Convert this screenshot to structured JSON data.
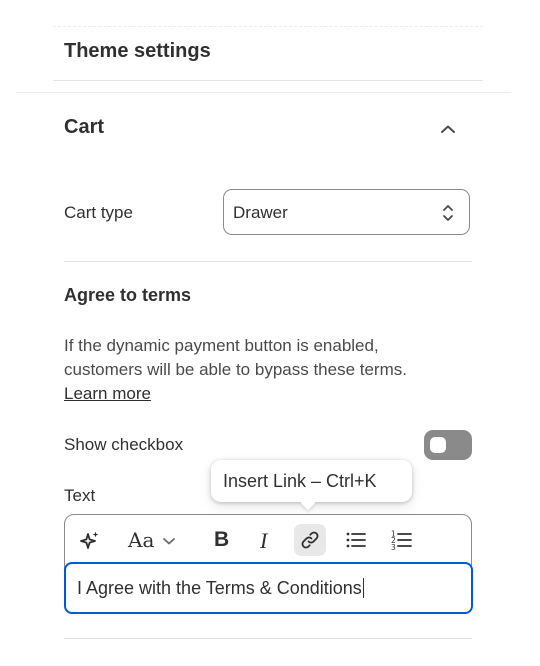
{
  "header": {
    "title": "Theme settings"
  },
  "cart_section": {
    "title": "Cart",
    "cart_type_label": "Cart type",
    "cart_type_value": "Drawer"
  },
  "agree_section": {
    "title": "Agree to terms",
    "description_line1": "If the dynamic payment button is enabled,",
    "description_line2": "customers will be able to bypass these terms.",
    "learn_more": "Learn more",
    "show_checkbox_label": "Show checkbox",
    "show_checkbox_on": false,
    "text_label": "Text",
    "text_value": "I Agree with the Terms & Conditions"
  },
  "editor_toolbar": {
    "icons": [
      "sparkle-icon",
      "font-icon",
      "chevron-down-icon",
      "bold-icon",
      "italic-icon",
      "link-icon",
      "bullet-list-icon",
      "numbered-list-icon"
    ],
    "font_glyph": "Aa",
    "bold_glyph": "B",
    "italic_glyph": "I",
    "numbered_digits": [
      "1",
      "2",
      "3"
    ]
  },
  "tooltip": {
    "text": "Insert Link – Ctrl+K"
  },
  "colors": {
    "focus_border": "#005bd3",
    "toggle_off": "#8a8a8a",
    "text": "#303030"
  }
}
